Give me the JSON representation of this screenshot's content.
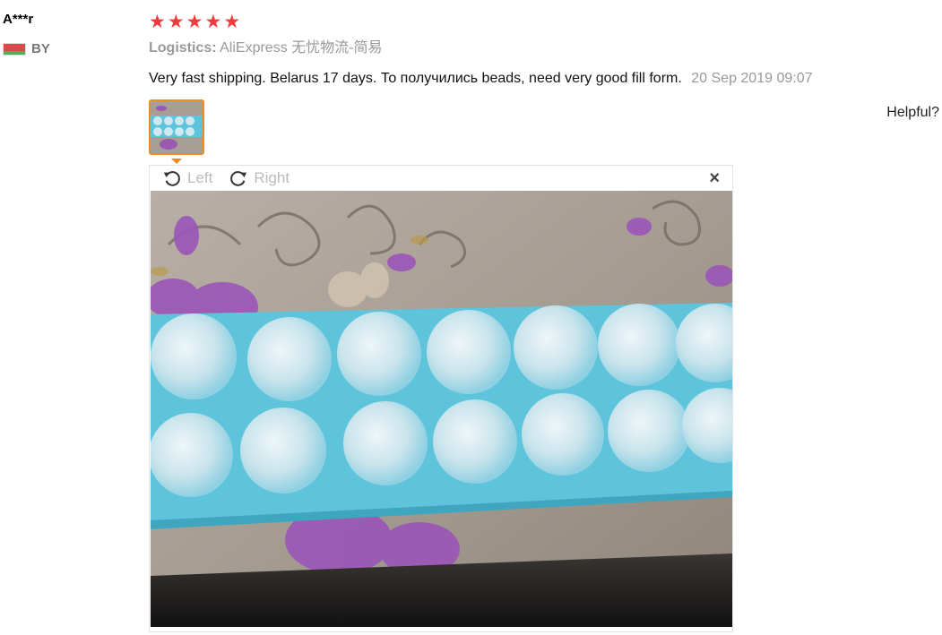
{
  "reviewer": {
    "name": "A***r",
    "country": "BY"
  },
  "rating": {
    "stars": 5,
    "max": 5,
    "color": "#ef3b3b"
  },
  "logistics": {
    "label": "Logistics:",
    "value": "AliExpress 无忧物流-简易"
  },
  "review": {
    "text": "Very fast shipping. Belarus 17 days. То получились beads, need very good fill form.",
    "date": "20 Sep 2019 09:07"
  },
  "helpful_label": "Helpful?",
  "viewer": {
    "rotate_left": "Left",
    "rotate_right": "Right",
    "close": "×"
  },
  "colors": {
    "accent": "#f08a24",
    "tray": "#5ec4dc"
  }
}
